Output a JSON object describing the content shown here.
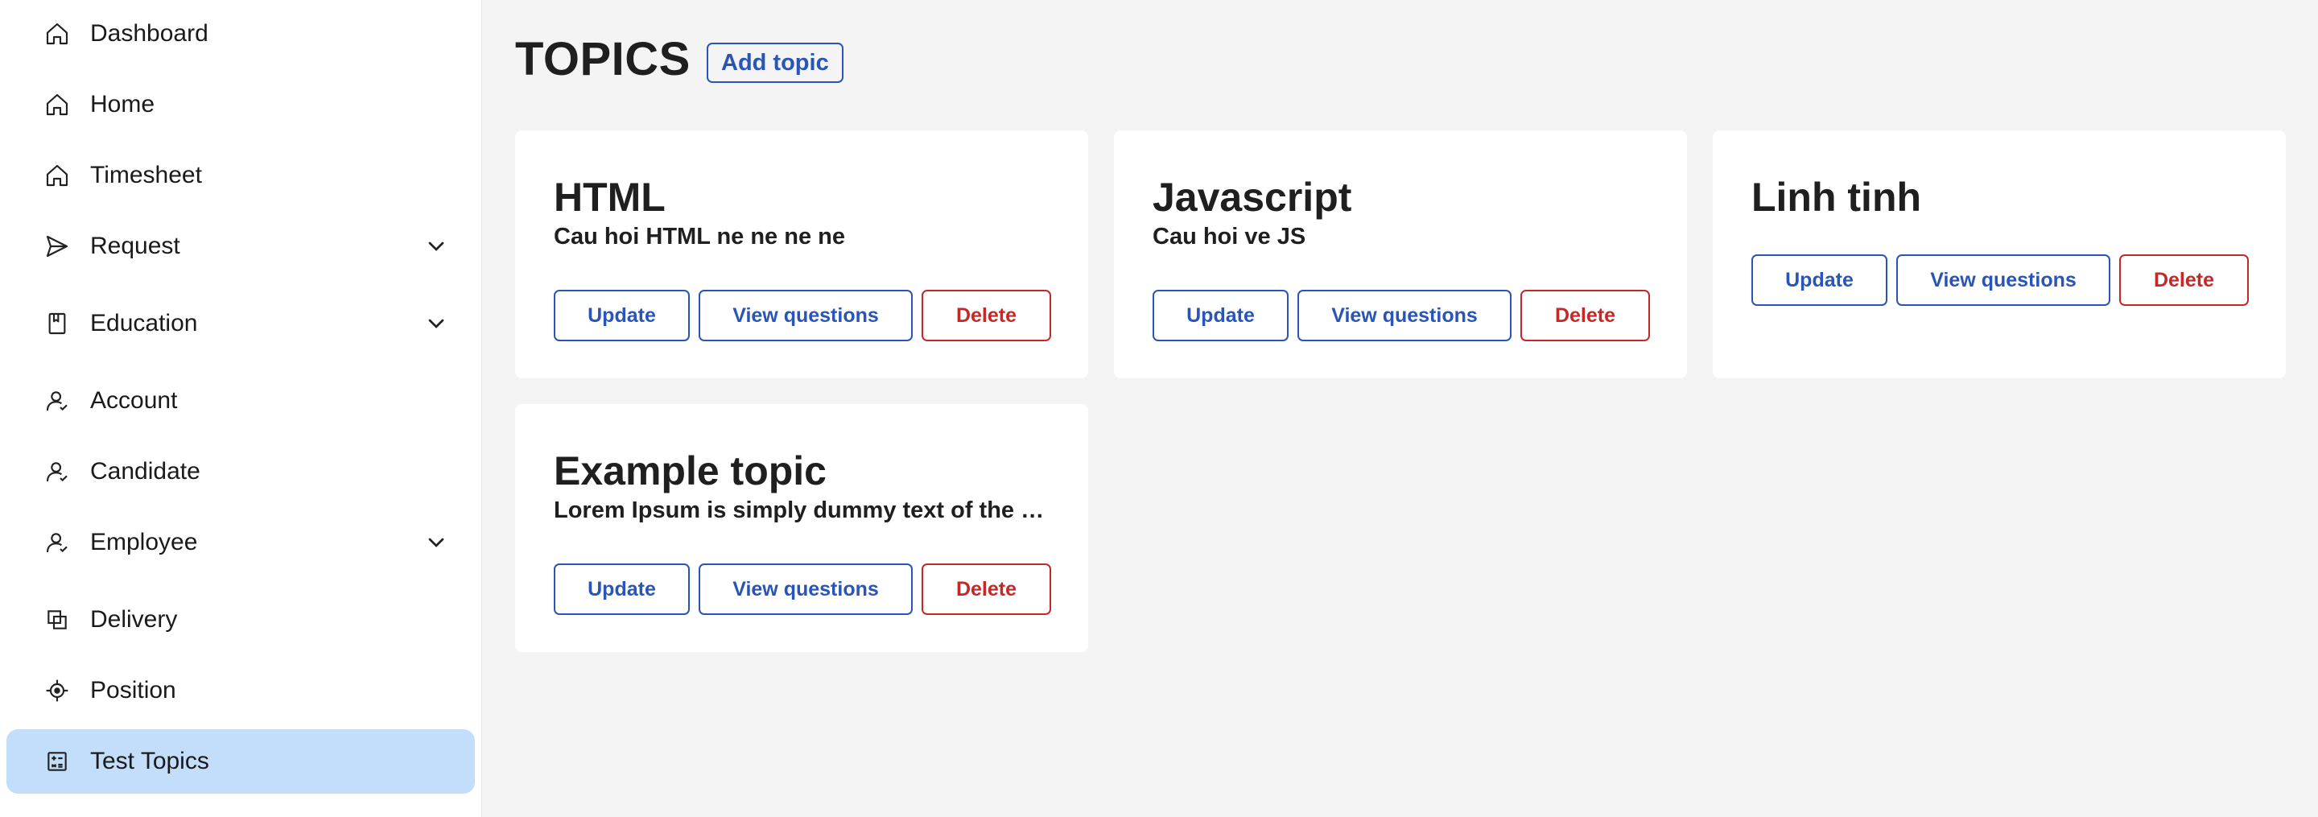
{
  "sidebar": {
    "items": [
      {
        "label": "Dashboard",
        "icon": "home-icon"
      },
      {
        "label": "Home",
        "icon": "home-icon"
      },
      {
        "label": "Timesheet",
        "icon": "home-icon"
      },
      {
        "label": "Request",
        "icon": "send-icon",
        "expandable": true
      },
      {
        "label": "Education",
        "icon": "book-icon",
        "expandable": true
      },
      {
        "label": "Account",
        "icon": "user-icon"
      },
      {
        "label": "Candidate",
        "icon": "user-icon"
      },
      {
        "label": "Employee",
        "icon": "user-icon",
        "expandable": true
      },
      {
        "label": "Delivery",
        "icon": "copy-icon"
      },
      {
        "label": "Position",
        "icon": "target-icon"
      },
      {
        "label": "Test Topics",
        "icon": "calculator-icon",
        "active": true
      }
    ]
  },
  "main": {
    "title": "TOPICS",
    "add_topic_label": "Add topic",
    "topics": [
      {
        "title": "HTML",
        "description": "Cau hoi HTML ne ne ne ne"
      },
      {
        "title": "Javascript",
        "description": "Cau hoi ve JS"
      },
      {
        "title": "Linh tinh",
        "description": ""
      },
      {
        "title": "Example topic",
        "description": "Lorem Ipsum is simply dummy text of the printing and typesetting industry."
      }
    ],
    "actions": {
      "update": "Update",
      "view_questions": "View questions",
      "delete": "Delete"
    }
  },
  "colors": {
    "accent": "#2a55b8",
    "danger": "#c62828",
    "active_bg": "#c2defa",
    "page_bg": "#f4f4f4"
  }
}
